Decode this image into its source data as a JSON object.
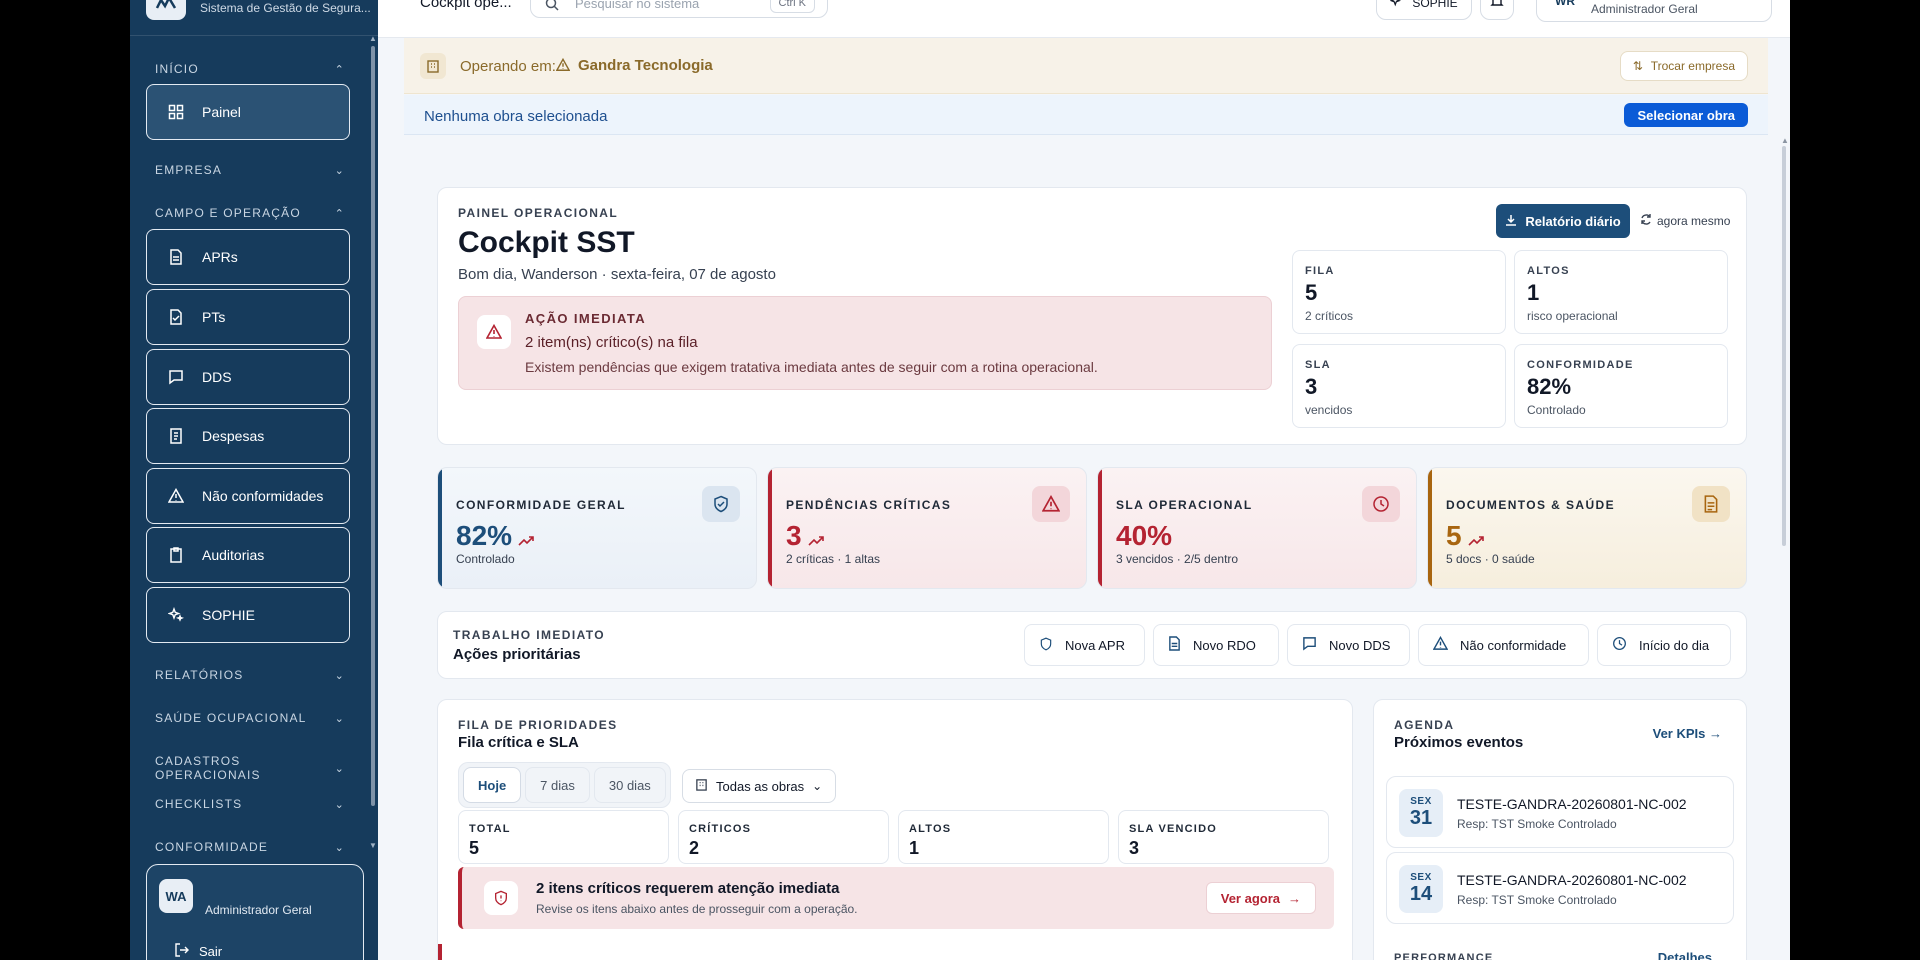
{
  "sidebar": {
    "brand_subtitle": "Sistema de Gestão de Segura...",
    "sections": {
      "inicio": "INÍCIO",
      "empresa": "EMPRESA",
      "campo": "CAMPO E OPERAÇÃO",
      "relatorios": "RELATÓRIOS",
      "saude": "SAÚDE OCUPACIONAL",
      "cadastros": "CADASTROS OPERACIONAIS",
      "checklists": "CHECKLISTS",
      "conformidade": "CONFORMIDADE"
    },
    "items": {
      "painel": "Painel",
      "aprs": "APRs",
      "pts": "PTs",
      "dds": "DDS",
      "despesas": "Despesas",
      "nao_conformidades": "Não conformidades",
      "auditorias": "Auditorias",
      "sophie": "SOPHIE"
    },
    "user": {
      "initials": "WA",
      "role": "Administrador Geral",
      "logout": "Sair"
    }
  },
  "topbar": {
    "title": "Cockpit ope...",
    "search_placeholder": "Pesquisar no sistema",
    "shortcut": "Ctrl K",
    "sophie": "SOPHIE",
    "user_initials": "WR",
    "user_role": "Administrador Geral"
  },
  "operating": {
    "label": "Operando em:",
    "company": "Gandra Tecnologia",
    "switch": "Trocar empresa"
  },
  "obra": {
    "label": "Nenhuma obra selecionada",
    "button": "Selecionar obra"
  },
  "hero": {
    "eyebrow": "PAINEL OPERACIONAL",
    "title": "Cockpit SST",
    "greeting": "Bom dia, Wanderson · sexta-feira, 07 de agosto",
    "alert": {
      "title": "AÇÃO IMEDIATA",
      "headline": "2 item(ns) crítico(s) na fila",
      "text": "Existem pendências que exigem tratativa imediata antes de seguir com a rotina operacional."
    },
    "report_button": "Relatório diário",
    "refresh": "agora mesmo",
    "mini": [
      {
        "key": "FILA",
        "value": "5",
        "desc": "2 críticos"
      },
      {
        "key": "ALTOS",
        "value": "1",
        "desc": "risco operacional"
      },
      {
        "key": "SLA",
        "value": "3",
        "desc": "vencidos"
      },
      {
        "key": "CONFORMIDADE",
        "value": "82%",
        "desc": "Controlado"
      }
    ]
  },
  "kpis": [
    {
      "key": "CONFORMIDADE GERAL",
      "value": "82%",
      "desc": "Controlado",
      "color": "#1d4e7a",
      "icon": "shield-check-icon"
    },
    {
      "key": "PENDÊNCIAS CRÍTICAS",
      "value": "3",
      "desc": "2 críticas · 1 altas",
      "color": "#b42332",
      "icon": "alert-triangle-icon"
    },
    {
      "key": "SLA OPERACIONAL",
      "value": "40%",
      "desc": "3 vencidos · 2/5 dentro",
      "color": "#b42332",
      "icon": "clock-icon"
    },
    {
      "key": "DOCUMENTOS & SAÚDE",
      "value": "5",
      "desc": "5 docs · 0 saúde",
      "color": "#a8650f",
      "icon": "document-icon"
    }
  ],
  "trabalho": {
    "eyebrow": "TRABALHO IMEDIATO",
    "title": "Ações prioritárias",
    "actions": [
      "Nova APR",
      "Novo RDO",
      "Novo DDS",
      "Não conformidade",
      "Início do dia"
    ]
  },
  "fila": {
    "eyebrow": "FILA DE PRIORIDADES",
    "title": "Fila crítica e SLA",
    "tabs": [
      "Hoje",
      "7 dias",
      "30 dias"
    ],
    "filter": "Todas as obras",
    "stats": [
      {
        "key": "TOTAL",
        "value": "5"
      },
      {
        "key": "CRÍTICOS",
        "value": "2"
      },
      {
        "key": "ALTOS",
        "value": "1"
      },
      {
        "key": "SLA VENCIDO",
        "value": "3"
      }
    ],
    "critical": {
      "headline": "2 itens críticos requerem atenção imediata",
      "text": "Revise os itens abaixo antes de prosseguir com a operação.",
      "button": "Ver agora"
    }
  },
  "agenda": {
    "eyebrow": "AGENDA",
    "title": "Próximos eventos",
    "link": "Ver KPIs →",
    "events": [
      {
        "weekday": "SEX",
        "day": "31",
        "name": "TESTE-GANDRA-20260801-NC-002",
        "resp": "Resp: TST Smoke Controlado"
      },
      {
        "weekday": "SEX",
        "day": "14",
        "name": "TESTE-GANDRA-20260801-NC-002",
        "resp": "Resp: TST Smoke Controlado"
      }
    ],
    "performance": "PERFORMANCE",
    "details": "Detalhes"
  }
}
